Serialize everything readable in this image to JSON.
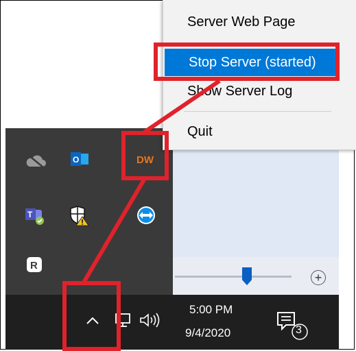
{
  "menu": {
    "items": [
      {
        "label": "Server Web Page"
      },
      {
        "label": "Stop Server (started)"
      },
      {
        "label": "Show Server Log"
      },
      {
        "label": "Quit"
      }
    ],
    "highlight_color": "#0078d7"
  },
  "tray": {
    "icons": [
      {
        "name": "onedrive-icon"
      },
      {
        "name": "outlook-icon",
        "text": "O"
      },
      {
        "name": "dw-server-icon",
        "text": "DW"
      },
      {
        "name": "teams-icon",
        "text": "T"
      },
      {
        "name": "defender-warning-icon"
      },
      {
        "name": "teamviewer-icon"
      },
      {
        "name": "r-app-icon",
        "text": "R"
      }
    ]
  },
  "taskbar": {
    "time": "5:00 PM",
    "date": "9/4/2020",
    "notification_count": "3"
  },
  "annotation_color": "#e0222b"
}
